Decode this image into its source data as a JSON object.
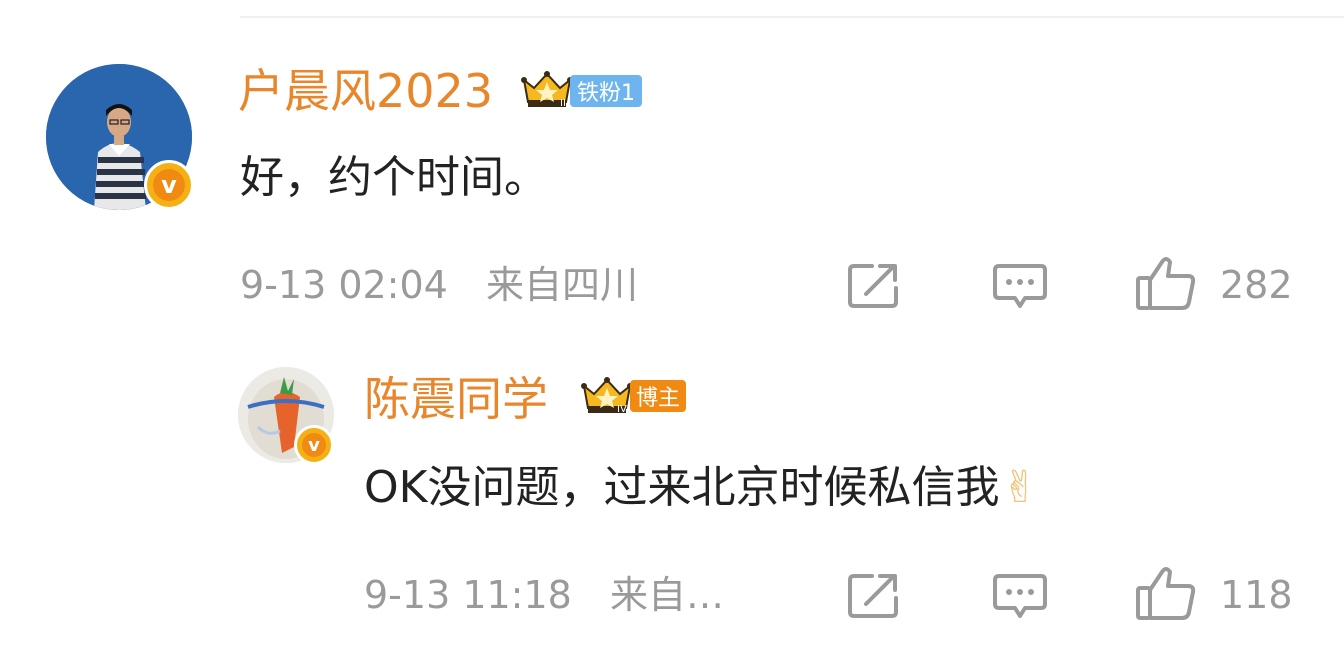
{
  "comment": {
    "username": "户晨风2023",
    "fan_badge": "铁粉1",
    "crown_level": "II",
    "text": "好，约个时间。",
    "time": "9-13 02:04",
    "location": "来自四川",
    "likes": "282",
    "verified_icon": "v-verified-icon",
    "accent_color": "#e8862c"
  },
  "reply": {
    "username": "陈震同学",
    "role_badge": "博主",
    "crown_level": "IV",
    "text": "OK没问题，过来北京时候私信我",
    "emoji": "✌",
    "time": "9-13 11:18",
    "location": "来自…",
    "likes": "118",
    "verified_icon": "v-verified-icon",
    "badge_color": "#f08a12"
  }
}
